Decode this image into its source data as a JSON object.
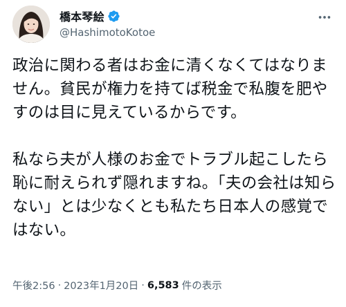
{
  "author": {
    "display_name": "橋本琴絵",
    "handle": "@HashimotoKotoe",
    "verified": true,
    "avatar_icon": "avatar-photo",
    "verified_icon": "verified-badge-icon",
    "verified_color": "#1d9bf0"
  },
  "menu": {
    "more_icon": "more-horizontal-icon"
  },
  "tweet": {
    "text": "政治に関わる者はお金に清くなくてはなりません。貧民が権力を持てば税金で私腹を肥やすのは目に見えているからです。\n\n私なら夫が人様のお金でトラブル起こしたら恥に耐えられず隠れますね。「夫の会社は知らない」とは少なくとも私たち日本人の感覚ではない。"
  },
  "meta": {
    "time": "午後2:56",
    "separator": "·",
    "date": "2023年1月20日",
    "separator2": "·",
    "views_count": "6,583",
    "views_label": "件の表示"
  },
  "colors": {
    "text": "#0f1419",
    "secondary": "#536471",
    "accent": "#1d9bf0"
  }
}
